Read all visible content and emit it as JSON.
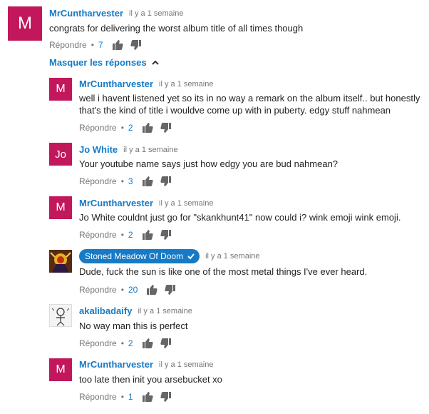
{
  "hide_replies_label": "Masquer les réponses",
  "reply_label": "Répondre",
  "separator": "•",
  "comments": [
    {
      "author": "MrCuntharvester",
      "time": "il y a 1 semaine",
      "text": "congrats for delivering the worst album title of all times though",
      "likes": "7",
      "avatar_letter": "M"
    },
    {
      "author": "MrCuntharvester",
      "time": "il y a 1 semaine",
      "text": "well i havent listened yet so its in no way a remark on the album itself.. but honestly that's the kind of title i wouldve come up with in puberty. edgy stuff nahmean",
      "likes": "2",
      "avatar_letter": "M"
    },
    {
      "author": "Jo White",
      "time": "il y a 1 semaine",
      "text": "Your youtube name says just how edgy you are bud nahmean?",
      "likes": "3",
      "avatar_letter": "Jo"
    },
    {
      "author": "MrCuntharvester",
      "time": "il y a 1 semaine",
      "text": "Jo White couldnt just go for \"skankhunt41\" now could i? wink emoji wink emoji.",
      "likes": "2",
      "avatar_letter": "M"
    },
    {
      "author": "Stoned Meadow Of Doom",
      "time": "il y a 1 semaine",
      "text": "Dude, fuck the sun is like one of the most metal things I've ever heard.",
      "likes": "20",
      "verified": true
    },
    {
      "author": "akalibadaify",
      "time": "il y a 1 semaine",
      "text": "No way man this is perfect",
      "likes": "2"
    },
    {
      "author": "MrCuntharvester",
      "time": "il y a 1 semaine",
      "text": "too late then init you arsebucket xo",
      "likes": "1",
      "avatar_letter": "M"
    }
  ],
  "colors": {
    "link": "#167ac6",
    "avatar_pink": "#c2185b",
    "muted": "#767676",
    "text": "#222222"
  }
}
